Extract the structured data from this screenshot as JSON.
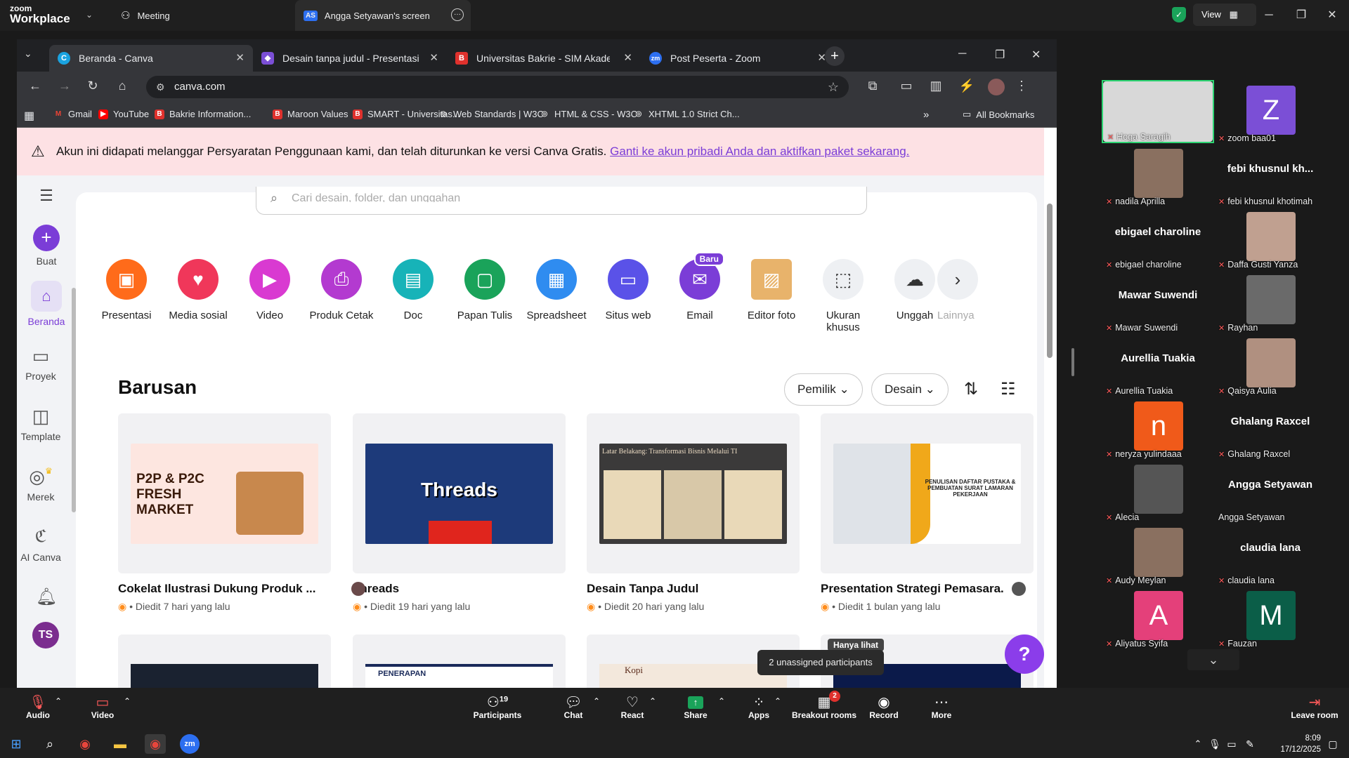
{
  "zoom": {
    "logo_top": "zoom",
    "logo_bottom": "Workplace",
    "tabs": [
      "Meeting",
      "Angga Setyawan's screen"
    ],
    "share_avatar": "AS",
    "view_label": "View",
    "tooltip": "2 unassigned participants",
    "toolbar": {
      "audio": "Audio",
      "video": "Video",
      "participants": "Participants",
      "participants_count": "19",
      "chat": "Chat",
      "react": "React",
      "share": "Share",
      "apps": "Apps",
      "breakout": "Breakout rooms",
      "breakout_badge": "2",
      "record": "Record",
      "more": "More",
      "leave": "Leave room"
    },
    "participants": [
      {
        "name": "Hoga Saragih",
        "type": "video"
      },
      {
        "name": "zoom baa01",
        "type": "letter",
        "letter": "Z",
        "color": "#7b4fd6"
      },
      {
        "name": "nadila Aprilla",
        "type": "video"
      },
      {
        "name": "febi khusnul khotimah",
        "type": "text",
        "big": "febi khusnul kh..."
      },
      {
        "name": "ebigael charoline",
        "type": "text",
        "big": "ebigael charoline"
      },
      {
        "name": "Daffa Gusti Yanza",
        "type": "video"
      },
      {
        "name": "Mawar Suwendi",
        "type": "text",
        "big": "Mawar Suwendi"
      },
      {
        "name": "Rayhan",
        "type": "video"
      },
      {
        "name": "Aurellia Tuakia",
        "type": "text",
        "big": "Aurellia Tuakia"
      },
      {
        "name": "Qaisya Aulia",
        "type": "video"
      },
      {
        "name": "neryza yulindaaa",
        "type": "letter",
        "letter": "n",
        "color": "#f05a1a"
      },
      {
        "name": "Ghalang Raxcel",
        "type": "text",
        "big": "Ghalang Raxcel"
      },
      {
        "name": "Alecia",
        "type": "video"
      },
      {
        "name": "Angga Setyawan",
        "type": "text",
        "big": "Angga Setyawan"
      },
      {
        "name": "Audy Meylan",
        "type": "video"
      },
      {
        "name": "claudia lana",
        "type": "text",
        "big": "claudia lana"
      },
      {
        "name": "Aliyatus Syifa",
        "type": "letter",
        "letter": "A",
        "color": "#e4407a"
      },
      {
        "name": "Fauzan",
        "type": "letter",
        "letter": "M",
        "color": "#0b5e48"
      }
    ]
  },
  "browser": {
    "tabs": [
      {
        "title": "Beranda - Canva",
        "fav": "C",
        "color": "#1aa3e0"
      },
      {
        "title": "Desain tanpa judul - Presentasi",
        "fav": "◆",
        "color": "#7b4fd6"
      },
      {
        "title": "Universitas Bakrie - SIM Akadem",
        "fav": "B",
        "color": "#e0312d"
      },
      {
        "title": "Post Peserta - Zoom",
        "fav": "zm",
        "color": "#2d6ff0"
      }
    ],
    "url": "canva.com",
    "bookmarks": [
      {
        "label": "Gmail",
        "ic": "M",
        "c": "#ea4335"
      },
      {
        "label": "YouTube",
        "ic": "▶",
        "c": "#ff0000"
      },
      {
        "label": "Bakrie Information...",
        "ic": "B",
        "c": "#e0312d"
      },
      {
        "label": "Maroon Values",
        "ic": "B",
        "c": "#e0312d"
      },
      {
        "label": "SMART - Universitas...",
        "ic": "B",
        "c": "#e0312d"
      },
      {
        "label": "Web Standards | W3C",
        "ic": "◎",
        "c": "#555"
      },
      {
        "label": "HTML & CSS - W3C",
        "ic": "◎",
        "c": "#555"
      },
      {
        "label": "XHTML 1.0 Strict Ch...",
        "ic": "◎",
        "c": "#555"
      }
    ],
    "all_bookmarks": "All Bookmarks"
  },
  "canva": {
    "banner_text": "Akun ini didapati melanggar Persyaratan Penggunaan kami, dan telah diturunkan ke versi Canva Gratis. ",
    "banner_link": "Ganti ke akun pribadi Anda dan aktifkan paket sekarang.",
    "search_placeholder": "Cari desain, folder, dan unggahan",
    "sidebar": [
      {
        "label": "Buat"
      },
      {
        "label": "Beranda"
      },
      {
        "label": "Proyek"
      },
      {
        "label": "Template"
      },
      {
        "label": "Merek"
      },
      {
        "label": "AI Canva"
      }
    ],
    "avatar": "TS",
    "categories": [
      {
        "label": "Presentasi",
        "color": "#ff6b1a",
        "icon": "▣"
      },
      {
        "label": "Media sosial",
        "color": "#f0375a",
        "icon": "♥"
      },
      {
        "label": "Video",
        "color": "#d93ad1",
        "icon": "▶"
      },
      {
        "label": "Produk Cetak",
        "color": "#b33ad0",
        "icon": "⎙"
      },
      {
        "label": "Doc",
        "color": "#17b3b8",
        "icon": "▤"
      },
      {
        "label": "Papan Tulis",
        "color": "#1aa35a",
        "icon": "▢"
      },
      {
        "label": "Spreadsheet",
        "color": "#2f8cf0",
        "icon": "▦"
      },
      {
        "label": "Situs web",
        "color": "#5a52e8",
        "icon": "▭"
      },
      {
        "label": "Email",
        "color": "#7b3dd7",
        "icon": "✉",
        "badge": "Baru"
      },
      {
        "label": "Editor foto",
        "color": "#e8b36b",
        "icon": "▨"
      },
      {
        "label": "Ukuran khusus",
        "color": "#eef0f3",
        "icon": "⬚"
      },
      {
        "label": "Unggah",
        "color": "#eef0f3",
        "icon": "☁"
      },
      {
        "label": "Lainnya",
        "color": "#eef0f3",
        "icon": "›"
      }
    ],
    "recent_title": "Barusan",
    "filter_owner": "Pemilik",
    "filter_type": "Desain",
    "cards": [
      {
        "title": "Cokelat Ilustrasi Dukung Produk ...",
        "meta": "Diedit 7 hari yang lalu",
        "thumb": "P2P & P2C FRESH MARKET"
      },
      {
        "title": "Threads",
        "meta": "Diedit 19 hari yang lalu",
        "thumb": "Threads"
      },
      {
        "title": "Desain Tanpa Judul",
        "meta": "Diedit 20 hari yang lalu",
        "thumb": "Latar Belakang: Transformasi Bisnis Melalui TI"
      },
      {
        "title": "Presentation Strategi Pemasara...",
        "meta": "Diedit 1 bulan yang lalu",
        "thumb": "PENULISAN DAFTAR PUSTAKA & PEMBUATAN SURAT LAMARAN PEKERJAAN"
      }
    ],
    "next_row": {
      "card2_text": "PENERAPAN",
      "card3_text": "Kopi",
      "card4_badge": "Hanya lihat"
    },
    "help": "?"
  },
  "taskbar": {
    "time": "8:09",
    "date": "17/12/2025"
  }
}
